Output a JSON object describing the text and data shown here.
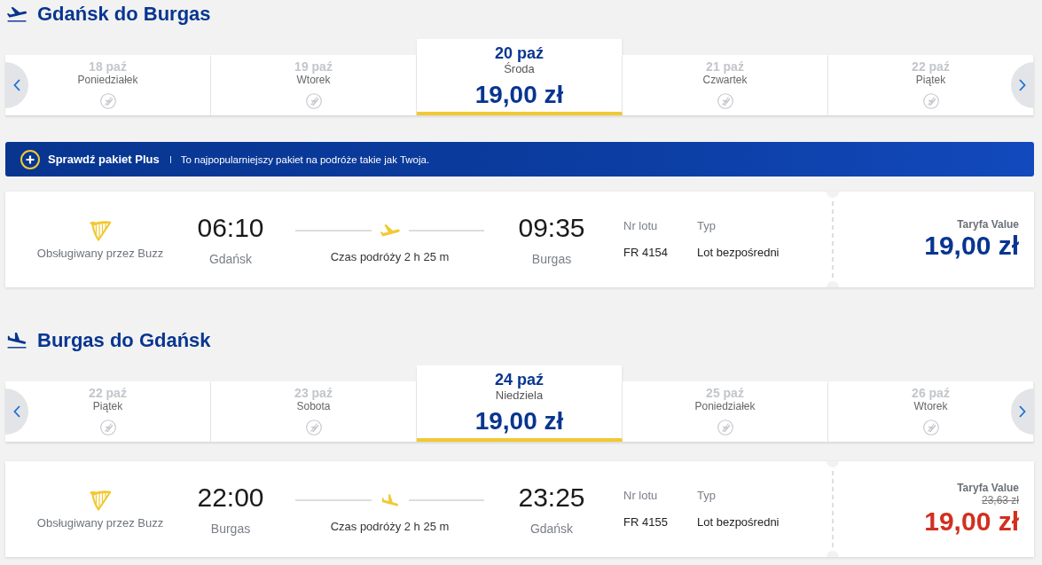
{
  "sections": [
    {
      "kind": "outbound",
      "title": "Gdańsk do Burgas",
      "dates": [
        {
          "date": "18 paź",
          "day": "Poniedziałek",
          "selected": false
        },
        {
          "date": "19 paź",
          "day": "Wtorek",
          "selected": false
        },
        {
          "date": "20 paź",
          "day": "Środa",
          "price": "19,00 zł",
          "selected": true
        },
        {
          "date": "21 paź",
          "day": "Czwartek",
          "selected": false
        },
        {
          "date": "22 paź",
          "day": "Piątek",
          "selected": false
        }
      ],
      "banner": {
        "title": "Sprawdź pakiet Plus",
        "text": "To najpopularniejszy pakiet na podróże takie jak Twoja."
      },
      "flight": {
        "operator": "Obsługiwany przez Buzz",
        "departure": {
          "time": "06:10",
          "city": "Gdańsk"
        },
        "duration": "Czas podróży 2 h 25 m",
        "arrival": {
          "time": "09:35",
          "city": "Burgas"
        },
        "flight_number": {
          "label": "Nr lotu",
          "value": "FR 4154"
        },
        "flight_type": {
          "label": "Typ",
          "value": "Lot bezpośredni"
        },
        "fare": {
          "name": "Taryfa Value",
          "price": "19,00 zł",
          "discounted": false
        }
      }
    },
    {
      "kind": "return",
      "title": "Burgas do Gdańsk",
      "dates": [
        {
          "date": "22 paź",
          "day": "Piątek",
          "selected": false
        },
        {
          "date": "23 paź",
          "day": "Sobota",
          "selected": false
        },
        {
          "date": "24 paź",
          "day": "Niedziela",
          "price": "19,00 zł",
          "selected": true
        },
        {
          "date": "25 paź",
          "day": "Poniedziałek",
          "selected": false
        },
        {
          "date": "26 paź",
          "day": "Wtorek",
          "selected": false
        }
      ],
      "flight": {
        "operator": "Obsługiwany przez Buzz",
        "departure": {
          "time": "22:00",
          "city": "Burgas"
        },
        "duration": "Czas podróży 2 h 25 m",
        "arrival": {
          "time": "23:25",
          "city": "Gdańsk"
        },
        "flight_number": {
          "label": "Nr lotu",
          "value": "FR 4155"
        },
        "flight_type": {
          "label": "Typ",
          "value": "Lot bezpośredni"
        },
        "fare": {
          "name": "Taryfa Value",
          "old_price": "23,63 zł",
          "price": "19,00 zł",
          "discounted": true
        }
      }
    }
  ]
}
